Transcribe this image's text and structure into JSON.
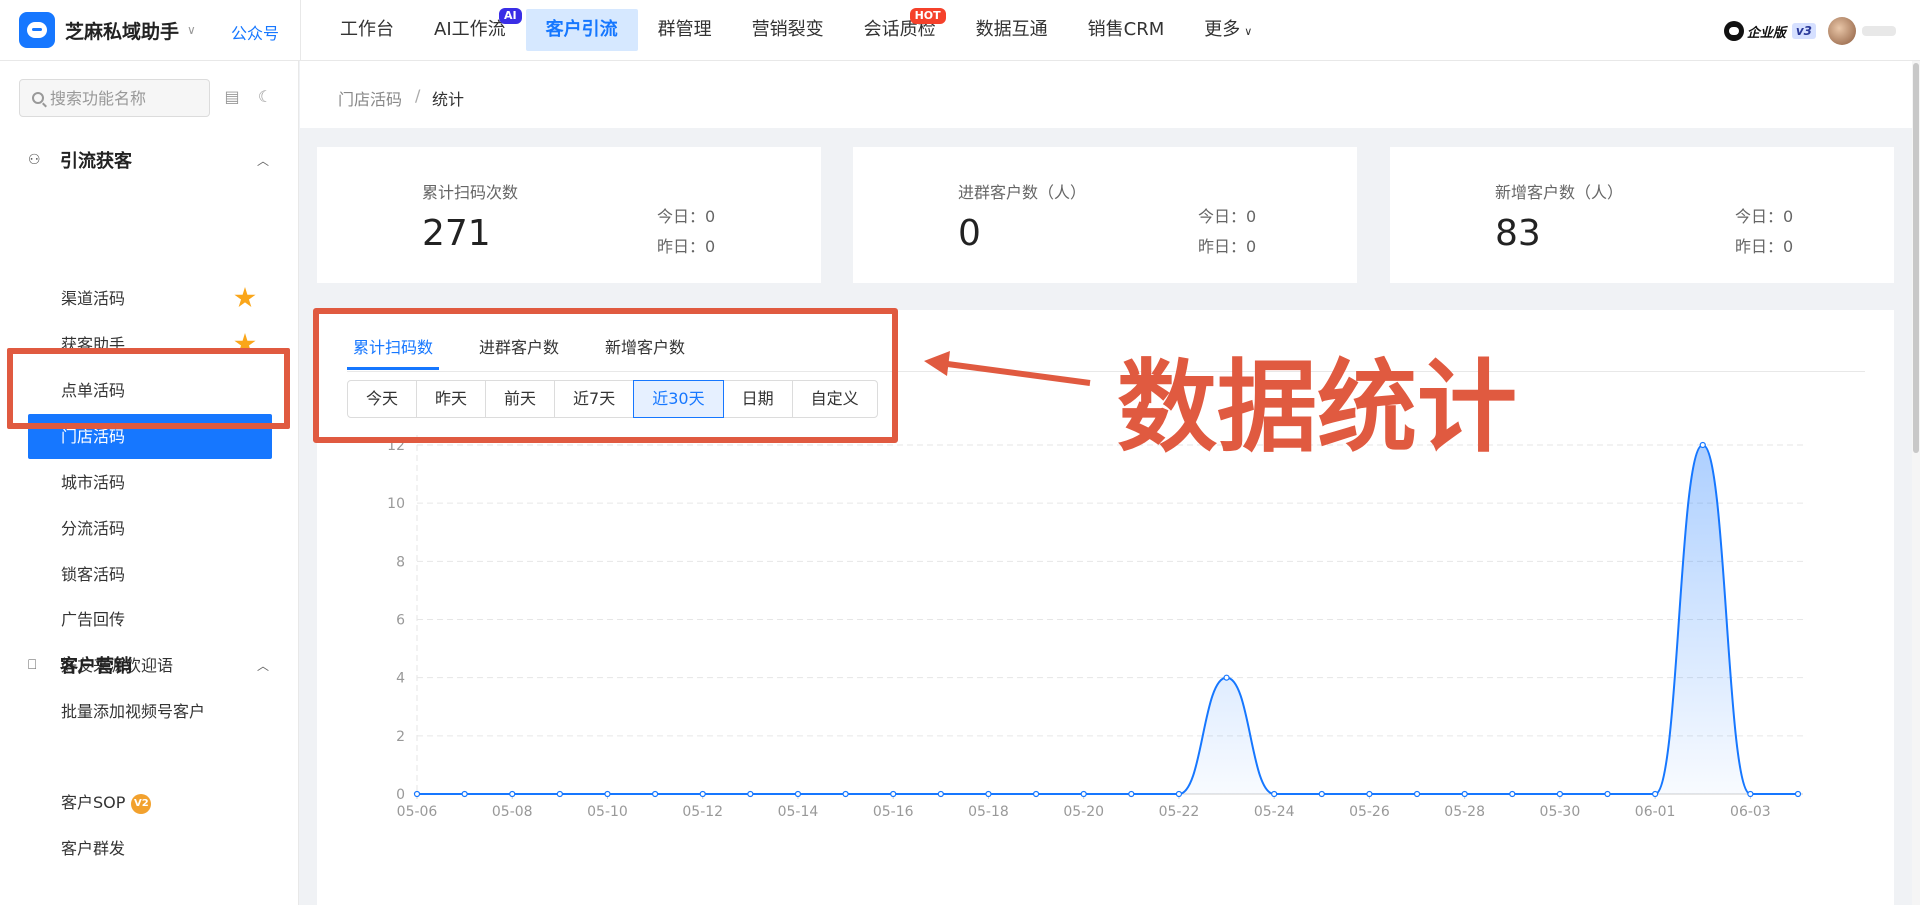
{
  "brand": {
    "name": "芝麻私域助手",
    "link": "公众号"
  },
  "nav": [
    {
      "label": "工作台"
    },
    {
      "label": "AI工作流",
      "badge": "AI"
    },
    {
      "label": "客户引流",
      "active": true
    },
    {
      "label": "群管理"
    },
    {
      "label": "营销裂变"
    },
    {
      "label": "会话质检",
      "badge": "HOT"
    },
    {
      "label": "数据互通"
    },
    {
      "label": "销售CRM"
    },
    {
      "label": "更多"
    }
  ],
  "account": {
    "edition": "企业版",
    "version": "v3"
  },
  "sidebar": {
    "search_placeholder": "搜索功能名称",
    "groups": [
      {
        "title": "引流获客",
        "items": [
          {
            "label": "渠道活码",
            "starred": true
          },
          {
            "label": "获客助手",
            "starred": true
          },
          {
            "label": "点单活码"
          },
          {
            "label": "门店活码",
            "active": true
          },
          {
            "label": "城市活码"
          },
          {
            "label": "分流活码"
          },
          {
            "label": "锁客活码"
          },
          {
            "label": "广告回传"
          },
          {
            "label": "好友来源欢迎语"
          },
          {
            "label": "批量添加视频号客户"
          }
        ]
      },
      {
        "title": "客户营销",
        "items": [
          {
            "label": "客户SOP",
            "badge": "V2"
          },
          {
            "label": "客户群发"
          }
        ]
      }
    ]
  },
  "breadcrumb": {
    "parent": "门店活码",
    "separator": "/",
    "current": "统计"
  },
  "stats": [
    {
      "title": "累计扫码次数",
      "value": "271",
      "today": "今日：0",
      "yesterday": "昨日：0"
    },
    {
      "title": "进群客户数（人）",
      "value": "0",
      "today": "今日：0",
      "yesterday": "昨日：0"
    },
    {
      "title": "新增客户数（人）",
      "value": "83",
      "today": "今日：0",
      "yesterday": "昨日：0"
    }
  ],
  "tabs": [
    "累计扫码数",
    "进群客户数",
    "新增客户数"
  ],
  "active_tab": 0,
  "ranges": [
    "今天",
    "昨天",
    "前天",
    "近7天",
    "近30天",
    "日期",
    "自定义"
  ],
  "active_range": 4,
  "annotation": {
    "label": "数据统计",
    "color": "#e05a40"
  },
  "colors": {
    "accent": "#1677ff",
    "star": "#faa61a"
  },
  "chart_data": {
    "type": "area",
    "x": [
      "05-06",
      "05-07",
      "05-08",
      "05-09",
      "05-10",
      "05-11",
      "05-12",
      "05-13",
      "05-14",
      "05-15",
      "05-16",
      "05-17",
      "05-18",
      "05-19",
      "05-20",
      "05-21",
      "05-22",
      "05-23",
      "05-24",
      "05-25",
      "05-26",
      "05-27",
      "05-28",
      "05-29",
      "05-30",
      "05-31",
      "06-01",
      "06-02",
      "06-03",
      "06-04"
    ],
    "values": [
      0,
      0,
      0,
      0,
      0,
      0,
      0,
      0,
      0,
      0,
      0,
      0,
      0,
      0,
      0,
      0,
      0,
      4,
      0,
      0,
      0,
      0,
      0,
      0,
      0,
      0,
      0,
      12,
      0,
      0
    ],
    "x_tick_labels": [
      "05-06",
      "05-08",
      "05-10",
      "05-12",
      "05-14",
      "05-16",
      "05-18",
      "05-20",
      "05-22",
      "05-24",
      "05-26",
      "05-28",
      "05-30",
      "06-01",
      "06-03"
    ],
    "y_ticks": [
      0,
      2,
      4,
      6,
      8,
      10,
      12
    ],
    "ylim": [
      0,
      12
    ],
    "grid": true,
    "color": "#1677ff"
  }
}
